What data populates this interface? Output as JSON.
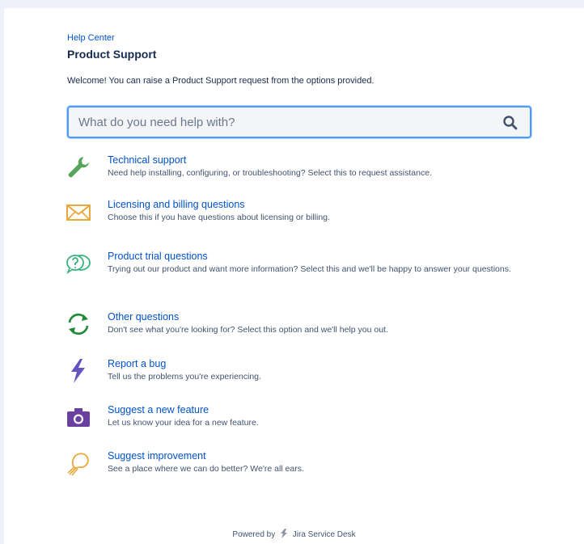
{
  "breadcrumb": {
    "help_center": "Help Center"
  },
  "page": {
    "title": "Product Support",
    "welcome": "Welcome! You can raise a Product Support request from the options provided."
  },
  "search": {
    "placeholder": "What do you need help with?",
    "value": ""
  },
  "options": [
    {
      "title": "Technical support",
      "description": "Need help installing, configuring, or troubleshooting? Select this to request assistance.",
      "icon": "wrench-icon"
    },
    {
      "title": "Licensing and billing questions",
      "description": "Choose this if you have questions about licensing or billing.",
      "icon": "envelope-icon"
    },
    {
      "title": "Product trial questions",
      "description": "Trying out our product and want more information? Select this and we'll be happy to answer your questions.",
      "icon": "question-bubble-icon"
    },
    {
      "title": "Other questions",
      "description": "Don't see what you're looking for? Select this option and we'll help you out.",
      "icon": "refresh-arrows-icon"
    },
    {
      "title": "Report a bug",
      "description": "Tell us the problems you're experiencing.",
      "icon": "lightning-bolt-icon"
    },
    {
      "title": "Suggest a new feature",
      "description": "Let us know your idea for a new feature.",
      "icon": "camera-icon"
    },
    {
      "title": "Suggest improvement",
      "description": "See a place where we can do better? We're all ears.",
      "icon": "lightbulb-icon"
    }
  ],
  "footer": {
    "powered_by": "Powered by",
    "product": "Jira Service Desk"
  },
  "colors": {
    "link": "#0052cc",
    "text": "#172b4d",
    "muted": "#42526e",
    "background": "#eef1fa",
    "search_border": "#4c9aff",
    "wrench": "#57a55a",
    "envelope": "#e8a83a",
    "question": "#36b37e",
    "refresh": "#1f8a3a",
    "bolt": "#6554c0",
    "camera": "#6b3fa0",
    "bulb": "#e8a83a"
  }
}
